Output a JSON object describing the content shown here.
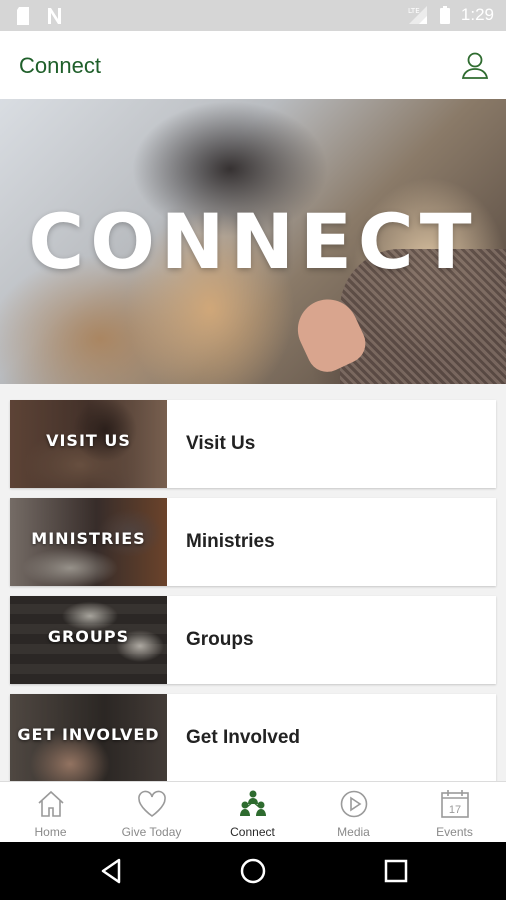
{
  "status_bar": {
    "time": "1:29",
    "left_icons": [
      "sd-card-icon",
      "notification-n-icon"
    ],
    "right_icons": [
      "signal-icon",
      "battery-icon"
    ],
    "signal_badge": "LTE"
  },
  "app_bar": {
    "title": "Connect",
    "profile_icon": "user-icon"
  },
  "hero": {
    "headline": "CONNECT"
  },
  "list": {
    "items": [
      {
        "thumb_label": "VISIT US",
        "label": "Visit Us"
      },
      {
        "thumb_label": "MINISTRIES",
        "label": "Ministries"
      },
      {
        "thumb_label": "GROUPS",
        "label": "Groups"
      },
      {
        "thumb_label": "GET INVOLVED",
        "label": "Get Involved"
      }
    ]
  },
  "bottom_nav": {
    "active": "Connect",
    "items": [
      {
        "label": "Home",
        "icon": "home-icon"
      },
      {
        "label": "Give Today",
        "icon": "heart-icon"
      },
      {
        "label": "Connect",
        "icon": "people-icon"
      },
      {
        "label": "Media",
        "icon": "play-icon"
      },
      {
        "label": "Events",
        "icon": "calendar-icon",
        "calendar_day": "17"
      }
    ]
  },
  "colors": {
    "brand_green": "#1f5f2a",
    "active_icon_green": "#2e6b2f",
    "inactive_gray": "#8a8a8a"
  }
}
